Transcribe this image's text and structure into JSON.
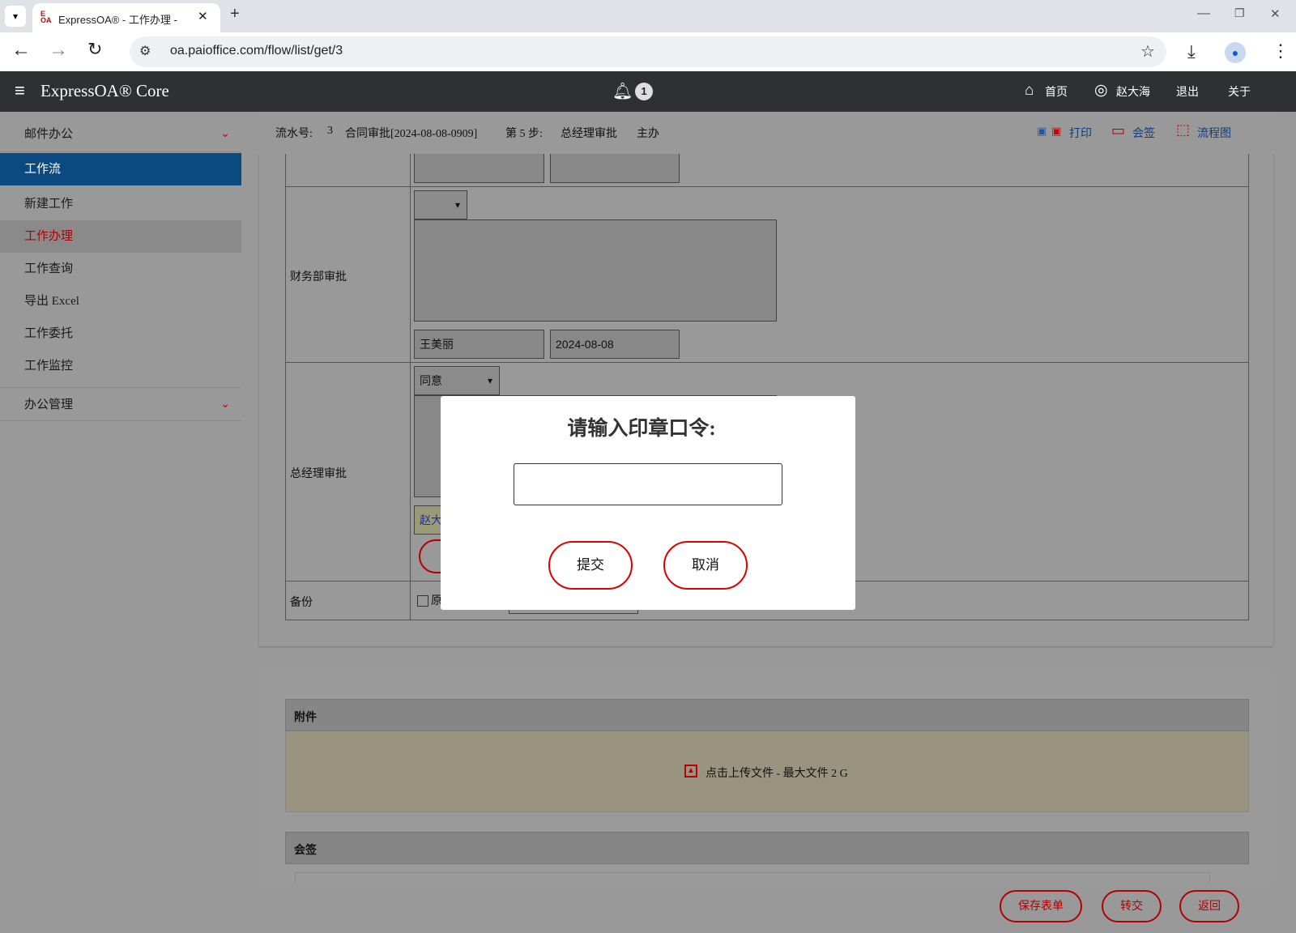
{
  "browser": {
    "tab_title": "ExpressOA® - 工作办理 - ",
    "url": "oa.paioffice.com/flow/list/get/3"
  },
  "app": {
    "brand": "ExpressOA® Core",
    "notification_count": "1",
    "nav": {
      "home": "首页",
      "user": "赵大海",
      "logout": "退出",
      "about": "关于"
    }
  },
  "sidebar": {
    "sections": [
      {
        "label": "邮件办公"
      },
      {
        "label": "工作流"
      },
      {
        "label": "办公管理"
      }
    ],
    "items": [
      "新建工作",
      "工作办理",
      "工作查询",
      "导出 Excel",
      "工作委托",
      "工作监控"
    ]
  },
  "flowbar": {
    "serial_label": "流水号:",
    "serial_no": "3",
    "flow_name": "合同审批[2024-08-08-0909]",
    "step": "第 5 步:",
    "step_name": "总经理审批",
    "role": "主办",
    "actions": {
      "print": "打印",
      "countersign": "会签",
      "flowchart": "流程图"
    }
  },
  "form": {
    "finance_label": "财务部审批",
    "finance_signer": "王美丽",
    "finance_date": "2024-08-08",
    "gm_label": "总经理审批",
    "gm_opinion": "同意",
    "gm_signer_partial": "赵大",
    "backup_label": "备份",
    "backup_option_partial": "原"
  },
  "attachments": {
    "header": "附件",
    "upload_text": "点击上传文件 - 最大文件 2 G"
  },
  "countersign": {
    "header": "会签"
  },
  "bottom_buttons": {
    "save": "保存表单",
    "transfer": "转交",
    "back": "返回"
  },
  "modal": {
    "title": "请输入印章口令:",
    "password_value": "",
    "submit": "提交",
    "cancel": "取消"
  }
}
